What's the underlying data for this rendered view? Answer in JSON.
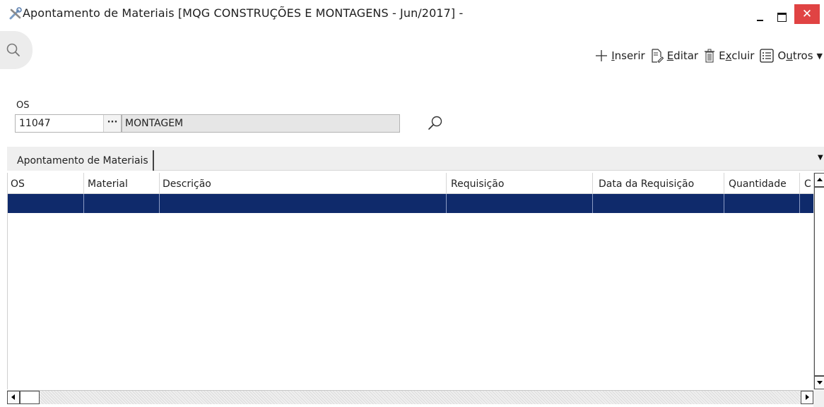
{
  "window": {
    "title": "Apontamento de Materiais [MQG CONSTRUÇÕES E MONTAGENS - Jun/2017] -",
    "close_label": "✕"
  },
  "toolbar": {
    "inserir": {
      "key": "I",
      "rest": "nserir"
    },
    "editar": {
      "key": "E",
      "rest": "ditar"
    },
    "excluir": {
      "pre": "E",
      "key": "x",
      "rest": "cluir"
    },
    "outros": {
      "pre": "O",
      "key": "u",
      "rest": "tros"
    }
  },
  "form": {
    "os_label": "OS",
    "os_code": "11047",
    "lookup_label": "···",
    "os_description": "MONTAGEM"
  },
  "tabs": [
    {
      "label": "Apontamento de Materiais",
      "active": true
    }
  ],
  "grid": {
    "columns": [
      "OS",
      "Material",
      "Descrição",
      "Requisição",
      "Data da Requisição",
      "Quantidade",
      "C"
    ],
    "selected_row_color": "#0f2a6b"
  },
  "colors": {
    "close_button": "#e04343",
    "selection": "#0f2a6b"
  }
}
